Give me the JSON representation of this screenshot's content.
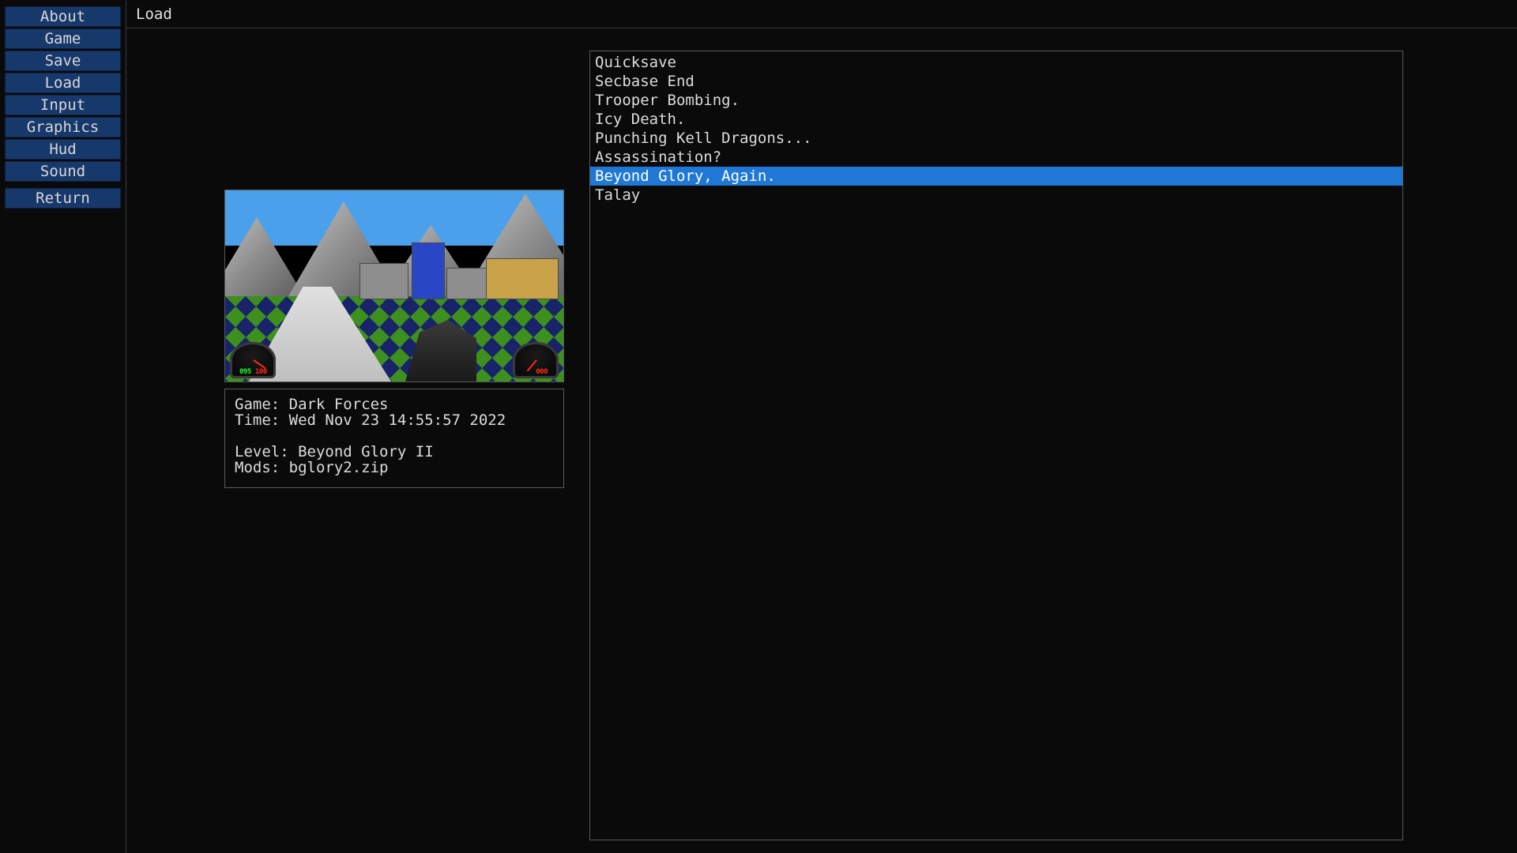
{
  "colors": {
    "background": "#0a0a0a",
    "sidebar_button_bg": "#17386b",
    "selection_bg": "#1f78d6",
    "border": "#5a5a5a"
  },
  "sidebar": {
    "items": [
      {
        "id": "about",
        "label": "About"
      },
      {
        "id": "game",
        "label": "Game"
      },
      {
        "id": "save",
        "label": "Save"
      },
      {
        "id": "load",
        "label": "Load"
      },
      {
        "id": "input",
        "label": "Input"
      },
      {
        "id": "graphics",
        "label": "Graphics"
      },
      {
        "id": "hud",
        "label": "Hud"
      },
      {
        "id": "sound",
        "label": "Sound"
      }
    ],
    "return_label": "Return"
  },
  "page_title": "Load",
  "details": {
    "game_label": "Game: ",
    "game_value": "Dark Forces",
    "time_label": "Time: ",
    "time_value": "Wed Nov 23 14:55:57 2022",
    "level_label": "Level: ",
    "level_value": "Beyond Glory II",
    "mods_label": "Mods: ",
    "mods_value": "bglory2.zip"
  },
  "saves": {
    "selected_index": 6,
    "items": [
      "Quicksave",
      "Secbase End",
      "Trooper Bombing.",
      "Icy Death.",
      "Punching Kell Dragons...",
      "Assassination?",
      "Beyond Glory, Again.",
      "Talay"
    ]
  },
  "hud": {
    "left_green": "095",
    "left_red": "100",
    "right_red": "000"
  }
}
